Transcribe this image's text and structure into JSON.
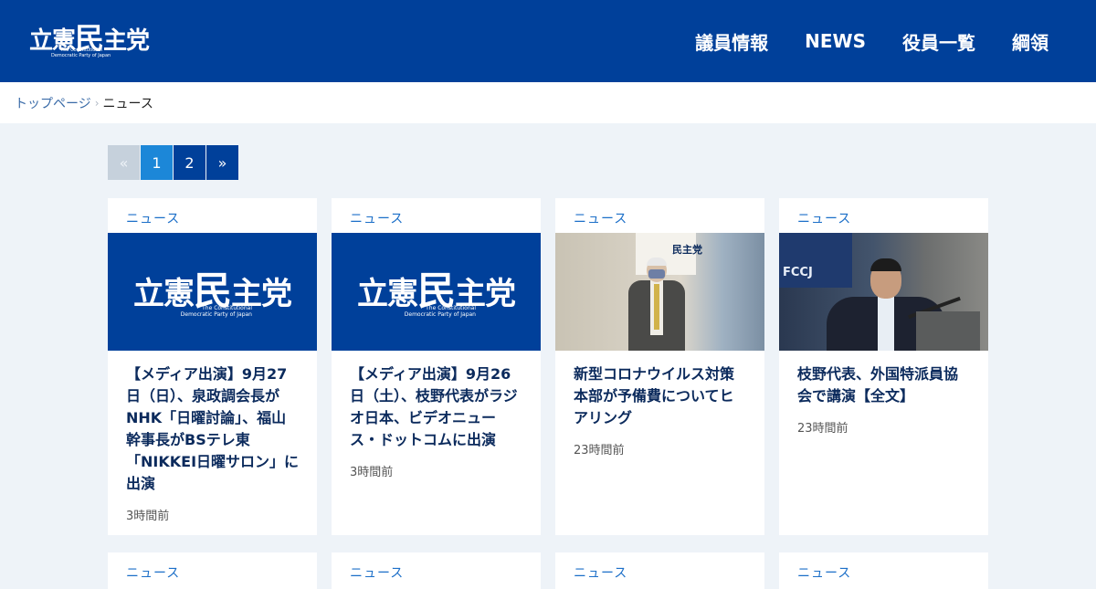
{
  "header": {
    "logo": {
      "main_small": "立憲",
      "main_big": "民",
      "main_end": "主党",
      "sub_line1": "The Constitutional",
      "sub_line2": "Democratic Party of Japan"
    },
    "nav": [
      {
        "label": "議員情報"
      },
      {
        "label": "NEWS"
      },
      {
        "label": "役員一覧"
      },
      {
        "label": "綱領"
      }
    ]
  },
  "breadcrumb": {
    "home": "トップページ",
    "separator": "›",
    "current": "ニュース"
  },
  "pagination": {
    "prev": "«",
    "pages": [
      "1",
      "2"
    ],
    "current": "1",
    "next": "»"
  },
  "cards": [
    {
      "category": "ニュース",
      "thumb_type": "logo",
      "title": "【メディア出演】9月27日（日）、泉政調会長がNHK「日曜討論」、福山幹事長がBSテレ東「NIKKEI日曜サロン」に出演",
      "time": "3時間前"
    },
    {
      "category": "ニュース",
      "thumb_type": "logo",
      "title": "【メディア出演】9月26日（土）、枝野代表がラジオ日本、ビデオニュース・ドットコムに出演",
      "time": "3時間前"
    },
    {
      "category": "ニュース",
      "thumb_type": "photo",
      "thumb_text": "民主党",
      "title": "新型コロナウイルス対策本部が予備費についてヒアリング",
      "time": "23時間前"
    },
    {
      "category": "ニュース",
      "thumb_type": "photo",
      "thumb_text": "FCCJ",
      "title": "枝野代表、外国特派員協会で講演【全文】",
      "time": "23時間前"
    }
  ],
  "next_row_categories": [
    "ニュース",
    "ニュース",
    "ニュース",
    "ニュース"
  ],
  "thumb_logo": {
    "small": "立憲",
    "big": "民",
    "end": "主党",
    "sub_line1": "The Constitutional",
    "sub_line2": "Democratic Party of Japan"
  },
  "colors": {
    "header_bg": "#00409a",
    "accent": "#1c87d8",
    "page_bg": "#eef3f8"
  }
}
